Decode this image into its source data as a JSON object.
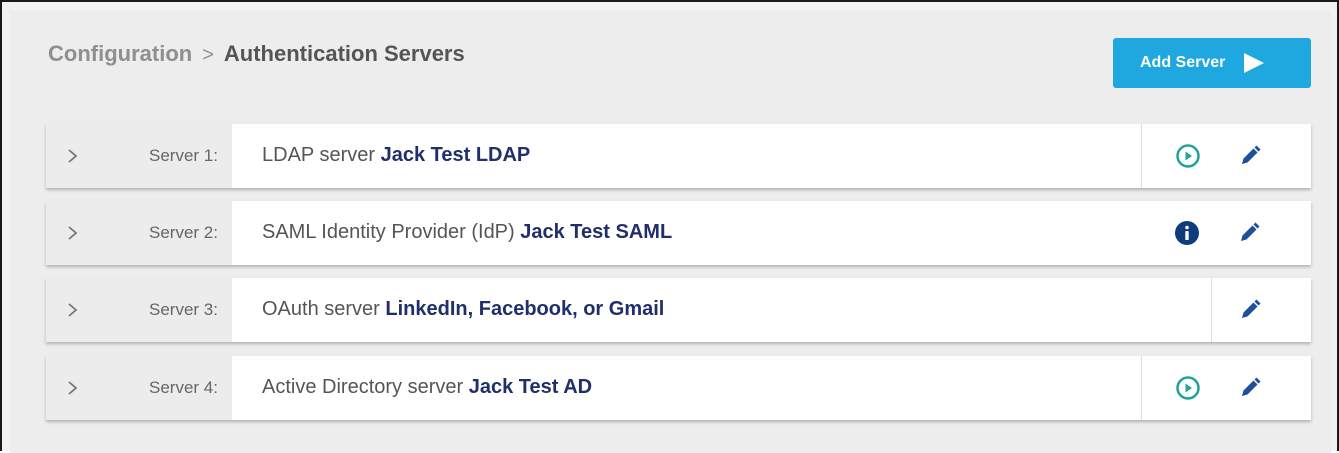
{
  "breadcrumb": {
    "parent": "Configuration",
    "separator": ">",
    "current": "Authentication Servers"
  },
  "add_button": {
    "label": "Add Server",
    "icon": "play-arrow-icon"
  },
  "servers": [
    {
      "label": "Server 1:",
      "type_text": "LDAP server",
      "name": "Jack Test LDAP",
      "status_icon": "play-circle-icon"
    },
    {
      "label": "Server 2:",
      "type_text": "SAML Identity Provider (IdP)",
      "name": "Jack Test SAML",
      "status_icon": "info-circle-icon"
    },
    {
      "label": "Server 3:",
      "type_text": "OAuth server",
      "name": "LinkedIn, Facebook, or Gmail",
      "status_icon": ""
    },
    {
      "label": "Server 4:",
      "type_text": "Active Directory server",
      "name": "Jack Test AD",
      "status_icon": "play-circle-icon"
    }
  ],
  "colors": {
    "accent": "#1fa7df",
    "server_name": "#1f2f6b",
    "edit_icon": "#1f4e9c",
    "play_icon": "#1fa39a",
    "info_icon": "#0f3c7a"
  }
}
